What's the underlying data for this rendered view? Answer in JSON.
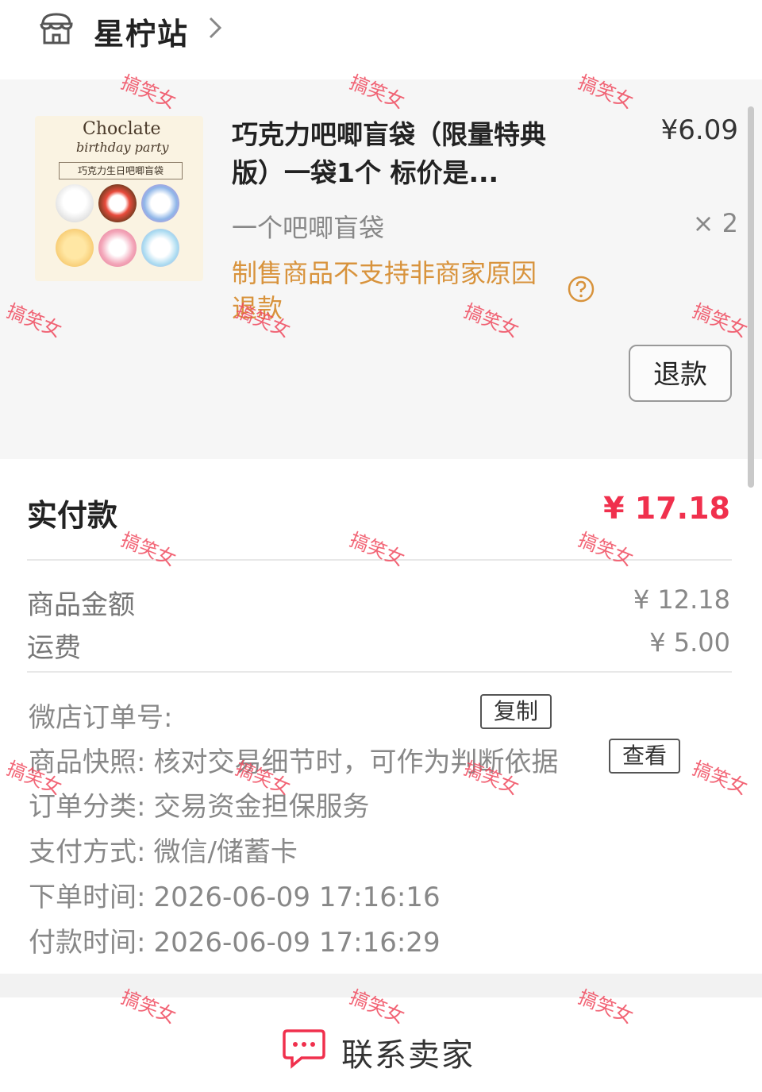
{
  "store": {
    "name": "星柠站",
    "icon": "store-icon"
  },
  "item": {
    "title": "巧克力吧唧盲袋（限量特典版）一袋1个 标价是...",
    "price": "¥6.09",
    "spec": "一个吧唧盲袋",
    "quantity": "× 2",
    "notice": "制售商品不支持非商家原因退款",
    "refund_button": "退款",
    "thumbnail": {
      "title_line1": "Choclate",
      "title_line2": "birthday party",
      "banner": "巧克力生日吧唧盲袋"
    }
  },
  "payment": {
    "paid_label": "实付款",
    "paid_value": "¥ 17.18",
    "rows": [
      {
        "label": "商品金额",
        "value": "¥ 12.18"
      },
      {
        "label": "运费",
        "value": "¥ 5.00"
      }
    ]
  },
  "order_info": {
    "order_no_label": "微店订单号:",
    "copy_button": "复制",
    "snapshot_label": "商品快照:",
    "snapshot_value": "核对交易细节时，可作为判断依据",
    "view_button": "查看",
    "category_label": "订单分类:",
    "category_value": "交易资金担保服务",
    "pay_method_label": "支付方式:",
    "pay_method_value": "微信/储蓄卡",
    "order_time_label": "下单时间:",
    "order_time_value": "2026-06-09 17:16:16",
    "pay_time_label": "付款时间:",
    "pay_time_value": "2026-06-09 17:16:29"
  },
  "bottom": {
    "contact_label": "联系卖家"
  },
  "watermark": "搞笑女",
  "colors": {
    "price_red": "#f0304d",
    "notice_orange": "#d8933c",
    "watermark": "#f04a5e"
  }
}
